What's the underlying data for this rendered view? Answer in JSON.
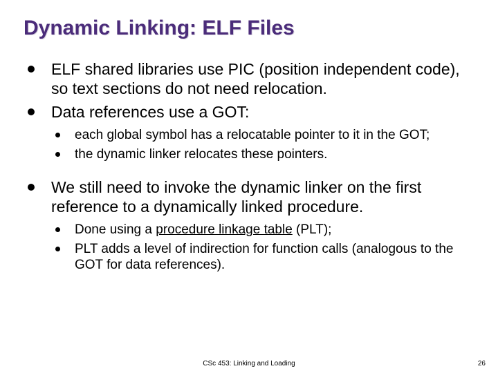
{
  "title": "Dynamic Linking: ELF Files",
  "bullets": {
    "b1": "ELF shared libraries use PIC (position independent code), so text sections do not need relocation.",
    "b2": "Data references use a GOT:",
    "b2a": "each global symbol has a relocatable pointer to it in the GOT;",
    "b2b": "the dynamic linker relocates these pointers.",
    "b3": "We still need to invoke the dynamic linker on the first reference to a dynamically linked procedure.",
    "b3a_pre": "Done using a ",
    "b3a_u": "procedure linkage table",
    "b3a_post": " (PLT);",
    "b3b": "PLT adds a level of indirection for function calls (analogous to the GOT for data references)."
  },
  "footer": {
    "center": "CSc 453: Linking and Loading",
    "page": "26"
  }
}
